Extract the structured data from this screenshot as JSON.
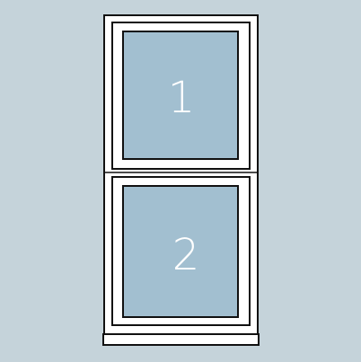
{
  "diagram": {
    "type": "single-hung-window",
    "colors": {
      "background": "#c5d3da",
      "frame": "#ffffff",
      "outline": "#111111",
      "glass": "#a2bfd0",
      "label": "#ffffff"
    },
    "panes": [
      {
        "label": "1"
      },
      {
        "label": "2"
      }
    ]
  }
}
